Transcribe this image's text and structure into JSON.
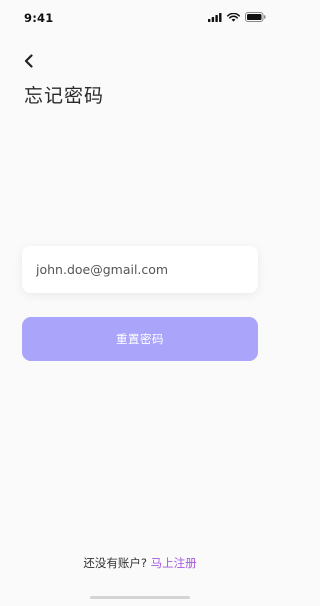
{
  "status_bar": {
    "time": "9:41",
    "icons": [
      "signal-icon",
      "wifi-icon",
      "battery-icon"
    ]
  },
  "header": {
    "back_icon": "chevron-left-icon",
    "title": "忘记密码"
  },
  "form": {
    "email_value": "john.doe@gmail.com",
    "submit_label": "重置密码"
  },
  "footer": {
    "prompt": "还没有账户?",
    "link": "马上注册"
  },
  "colors": {
    "accent": "#aaa4fb",
    "link": "#a55bdf",
    "background": "#fafafa"
  }
}
